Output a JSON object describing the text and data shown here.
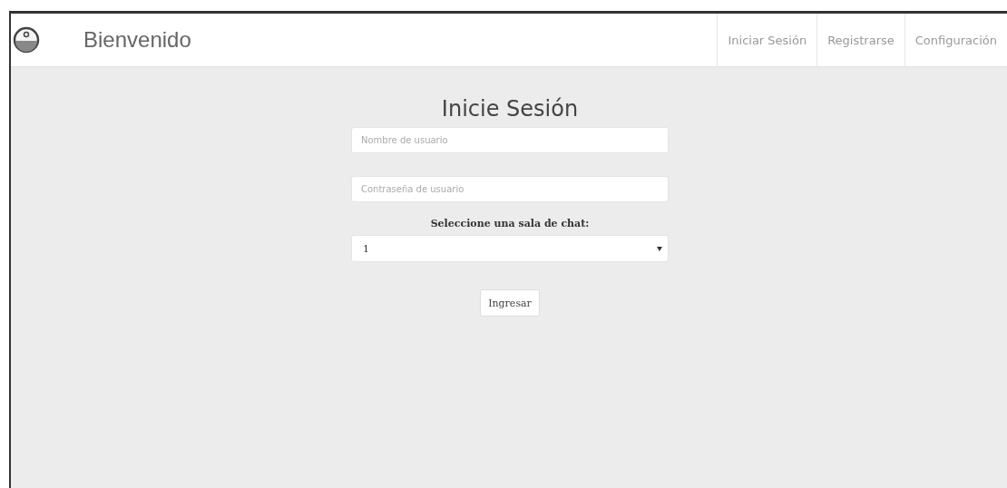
{
  "navbar": {
    "brand": "Bienvenido",
    "links": [
      {
        "label": "Iniciar Sesión"
      },
      {
        "label": "Registrarse"
      },
      {
        "label": "Configuración"
      }
    ]
  },
  "form": {
    "title": "Inicie Sesión",
    "fields": [
      {
        "placeholder": "Nombre de usuario"
      },
      {
        "placeholder": "Contraseña de usuario"
      }
    ],
    "select_label": "Seleccione una sala de chat:",
    "select_value": "1",
    "submit": "Ingresar"
  }
}
